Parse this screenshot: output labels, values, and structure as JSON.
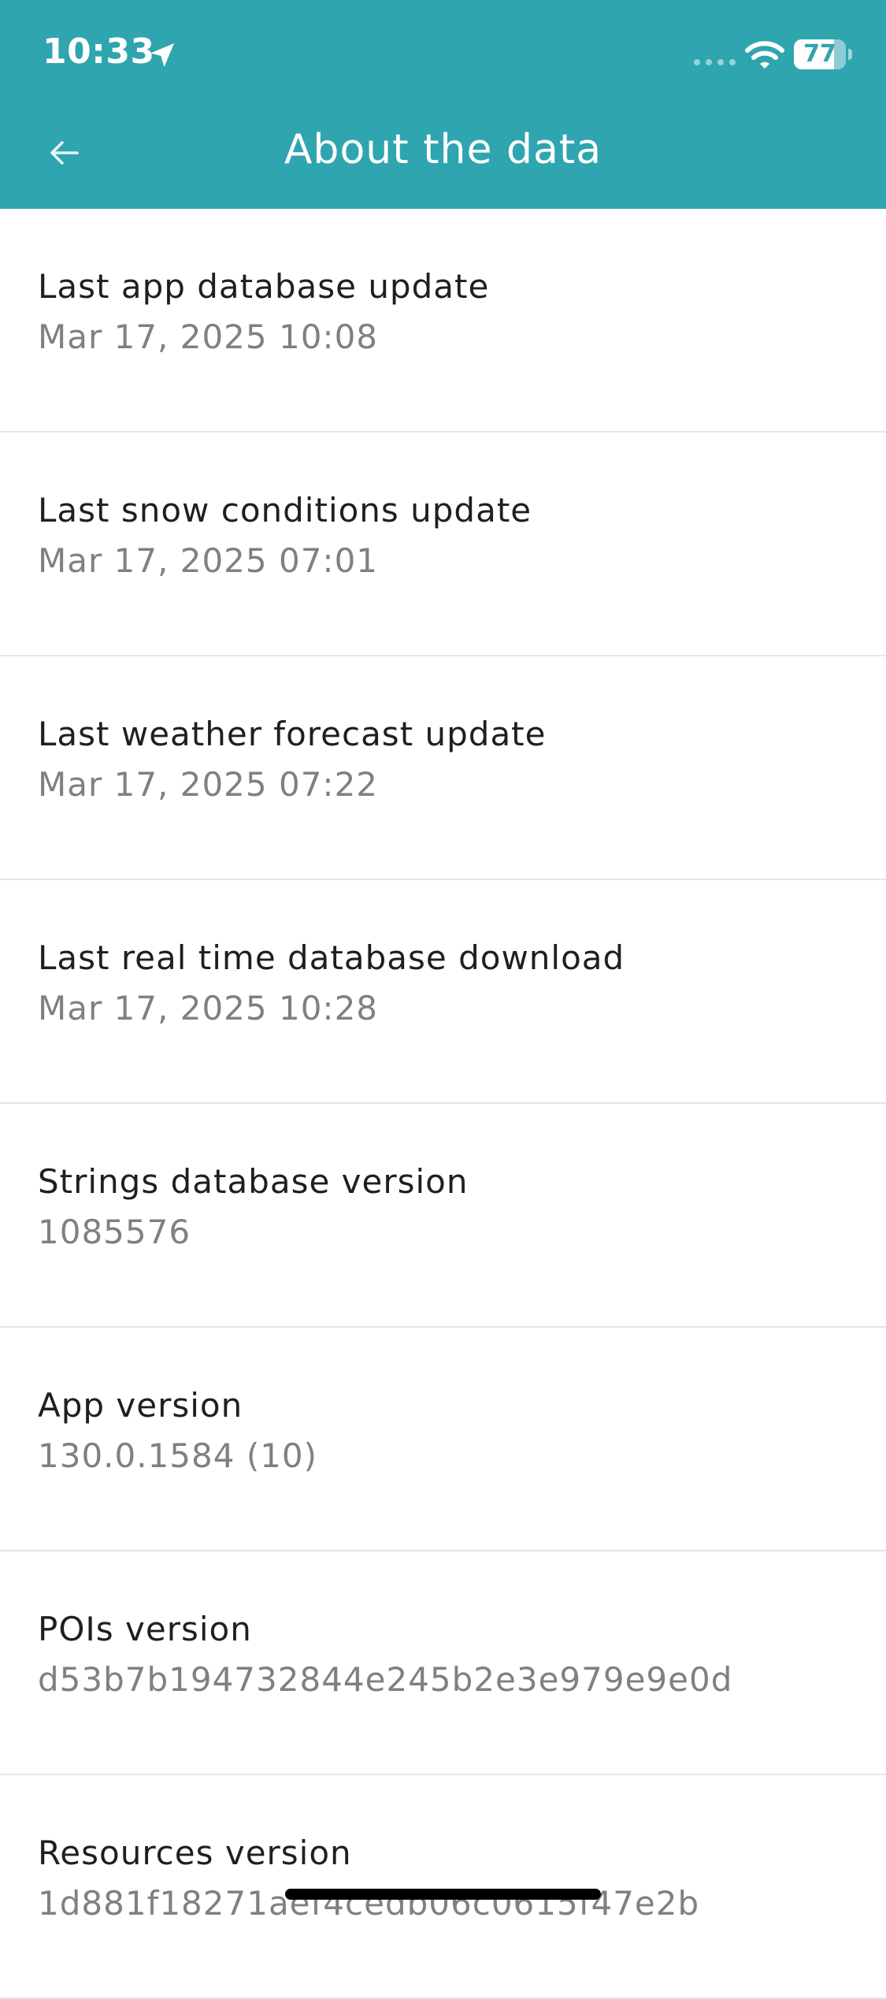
{
  "status_bar": {
    "time": "10:33",
    "battery": "77",
    "battery_level": 0.77
  },
  "header": {
    "title": "About the data"
  },
  "items": [
    {
      "title": "Last app database update",
      "value": "Mar 17, 2025 10:08"
    },
    {
      "title": "Last snow conditions update",
      "value": "Mar 17, 2025 07:01"
    },
    {
      "title": "Last weather forecast update",
      "value": "Mar 17, 2025 07:22"
    },
    {
      "title": "Last real time database download",
      "value": "Mar 17, 2025 10:28"
    },
    {
      "title": "Strings database version",
      "value": "1085576"
    },
    {
      "title": "App version",
      "value": "130.0.1584 (10)"
    },
    {
      "title": "POIs version",
      "value": "d53b7b194732844e245b2e3e979e9e0d"
    },
    {
      "title": "Resources version",
      "value": "1d881f18271aef4cedb06c0615f47e2b"
    }
  ],
  "colors": {
    "header_bg": "#2fa5b0",
    "title_text": "#1f1f1f",
    "value_text": "#808080",
    "divider": "#e6e6e6"
  }
}
